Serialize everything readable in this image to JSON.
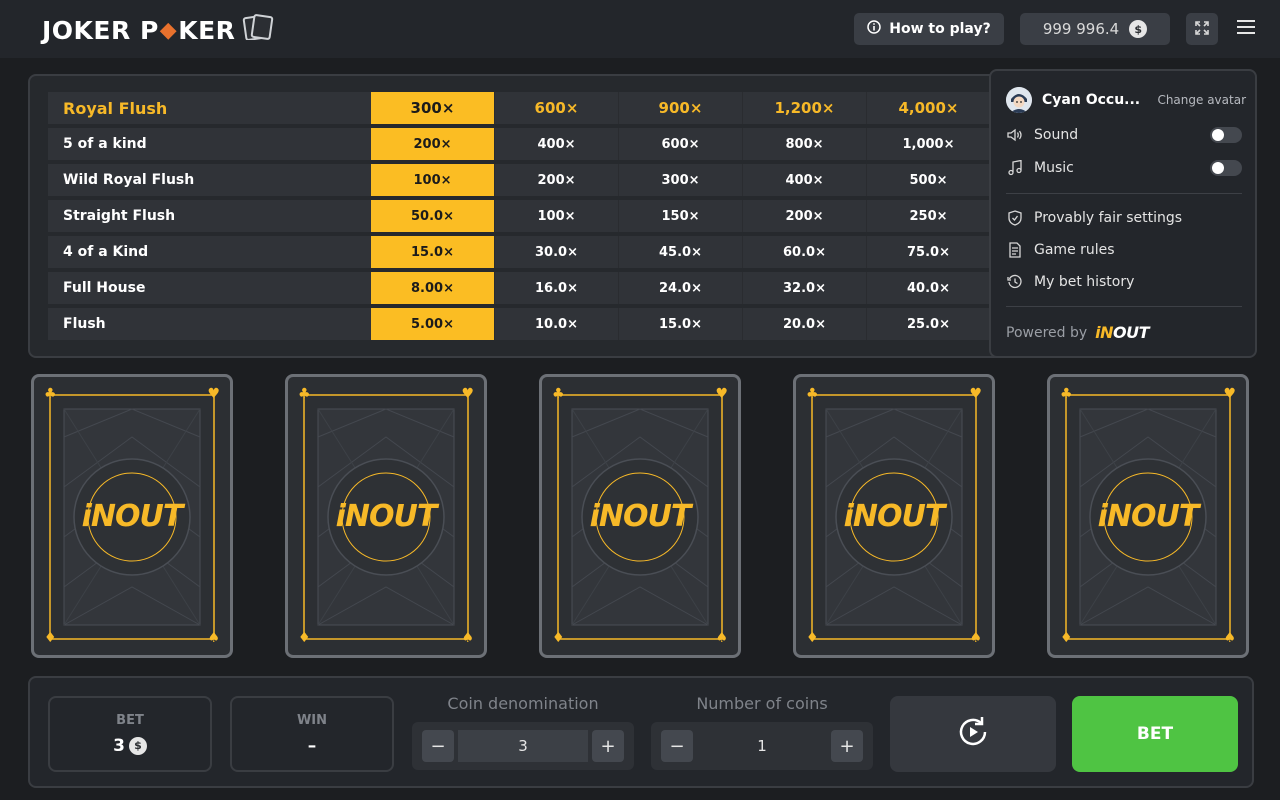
{
  "header": {
    "logo_part1": "JOKER P",
    "logo_diamond": "◆",
    "logo_part2": "KER",
    "how_to_play": "How to play?",
    "balance": "999 996.4",
    "currency_symbol": "$"
  },
  "paytable": {
    "active_column": 0,
    "rows": [
      {
        "name": "Royal Flush",
        "values": [
          "300×",
          "600×",
          "900×",
          "1,200×",
          "4,000×"
        ]
      },
      {
        "name": "5 of a kind",
        "values": [
          "200×",
          "400×",
          "600×",
          "800×",
          "1,000×"
        ]
      },
      {
        "name": "Wild Royal Flush",
        "values": [
          "100×",
          "200×",
          "300×",
          "400×",
          "500×"
        ]
      },
      {
        "name": "Straight Flush",
        "values": [
          "50.0×",
          "100×",
          "150×",
          "200×",
          "250×"
        ]
      },
      {
        "name": "4 of a Kind",
        "values": [
          "15.0×",
          "30.0×",
          "45.0×",
          "60.0×",
          "75.0×"
        ]
      },
      {
        "name": "Full House",
        "values": [
          "8.00×",
          "16.0×",
          "24.0×",
          "32.0×",
          "40.0×"
        ]
      },
      {
        "name": "Flush",
        "values": [
          "5.00×",
          "10.0×",
          "15.0×",
          "20.0×",
          "25.0×"
        ]
      }
    ]
  },
  "menu": {
    "user_name": "Cyan Occu...",
    "change_avatar": "Change avatar",
    "sound_label": "Sound",
    "sound_on": false,
    "music_label": "Music",
    "music_on": false,
    "provably_fair": "Provably fair settings",
    "game_rules": "Game rules",
    "bet_history": "My bet history",
    "powered_by": "Powered by",
    "brand_i": "iN",
    "brand_rest": "OUT"
  },
  "cards": {
    "count": 5,
    "logo_i": "iN",
    "logo_rest": "OUT",
    "suit_top_left": "♣",
    "suit_top_right": "♥",
    "suit_bottom_left": "♦",
    "suit_bottom_right": "♠"
  },
  "bottom": {
    "bet_label": "BET",
    "bet_value": "3",
    "win_label": "WIN",
    "win_value": "–",
    "coin_denomination_label": "Coin denomination",
    "coin_denomination_value": "3",
    "coins_label": "Number of coins",
    "coins_value": "1",
    "minus": "−",
    "plus": "+",
    "bet_button": "BET"
  },
  "colors": {
    "accent": "#fbbd23",
    "bet_green": "#4fc443",
    "background": "#1b1d20"
  }
}
